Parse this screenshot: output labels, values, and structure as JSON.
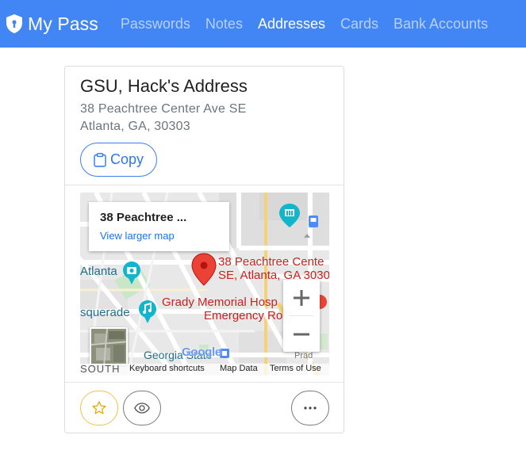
{
  "app": {
    "brand": "My Pass",
    "nav": [
      {
        "label": "Passwords",
        "active": false
      },
      {
        "label": "Notes",
        "active": false
      },
      {
        "label": "Addresses",
        "active": true
      },
      {
        "label": "Cards",
        "active": false
      },
      {
        "label": "Bank Accounts",
        "active": false
      }
    ],
    "accent_color": "#4285f4"
  },
  "address_card": {
    "title": "GSU, Hack's Address",
    "street": "38 Peachtree Center Ave SE",
    "city_line": "Atlanta, GA, 30303",
    "copy_label": "Copy",
    "icons": {
      "copy": "clipboard-icon",
      "favorite": "star-icon",
      "view": "eye-icon",
      "more": "more-horizontal-icon"
    },
    "favorite_color": "#f2c14e"
  },
  "map": {
    "info_title": "38 Peachtree ...",
    "info_link": "View larger map",
    "marker_label_line1": "38 Peachtree Cente",
    "marker_label_line2": "SE, Atlanta, GA 3030",
    "labels": {
      "atlanta": "Atlanta",
      "grady_line1": "Grady Memorial Hosp",
      "grady_line2": "Emergency Ro",
      "esquerade": "squerade",
      "georgia_state": "Georgia State",
      "south": "SOUTH",
      "google": "Google",
      "prado": "Prad"
    },
    "footer": {
      "shortcuts": "Keyboard shortcuts",
      "map_data": "Map Data",
      "terms": "Terms of Use"
    },
    "zoom_in": "+",
    "zoom_out": "−"
  }
}
